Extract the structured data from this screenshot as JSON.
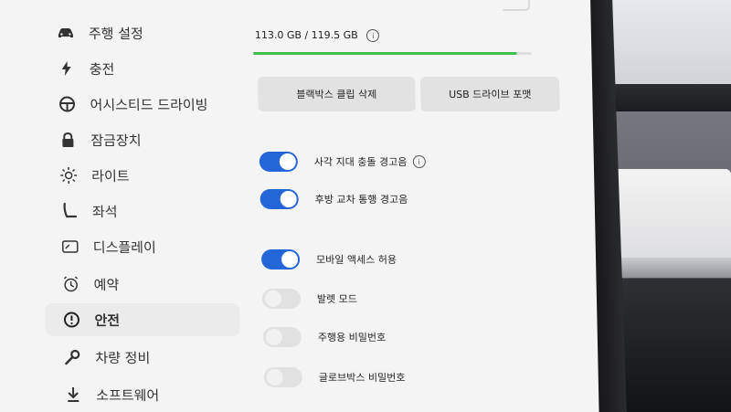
{
  "sidebar": {
    "items": [
      {
        "label": "주행 설정",
        "icon": "car-icon"
      },
      {
        "label": "충전",
        "icon": "lightning-icon"
      },
      {
        "label": "어시스티드 드라이빙",
        "icon": "steering-wheel-icon"
      },
      {
        "label": "잠금장치",
        "icon": "lock-icon"
      },
      {
        "label": "라이트",
        "icon": "light-icon"
      },
      {
        "label": "좌석",
        "icon": "seat-icon"
      },
      {
        "label": "디스플레이",
        "icon": "display-icon"
      },
      {
        "label": "예약",
        "icon": "alarm-icon"
      },
      {
        "label": "안전",
        "icon": "alert-circle-icon",
        "active": true
      },
      {
        "label": "차량 정비",
        "icon": "wrench-icon"
      },
      {
        "label": "소프트웨어",
        "icon": "download-icon"
      }
    ]
  },
  "storage": {
    "text": "113.0 GB / 119.5 GB",
    "used_fraction": 0.946
  },
  "buttons": {
    "delete_dashcam": "블랙박스 클립 삭제",
    "format_usb": "USB 드라이브 포맷"
  },
  "toggles": [
    {
      "label": "사각 지대 충돌 경고음",
      "on": true,
      "info": true
    },
    {
      "label": "후방 교차 통행 경고음",
      "on": true
    },
    {
      "label": "모바일 액세스 허용",
      "on": true
    },
    {
      "label": "발렛 모드",
      "on": false
    },
    {
      "label": "주행용 비밀번호",
      "on": false
    },
    {
      "label": "글로브박스 비밀번호",
      "on": false
    }
  ],
  "colors": {
    "accent": "#2466d8",
    "progress": "#3fbf52",
    "background": "#f4f4f4"
  }
}
